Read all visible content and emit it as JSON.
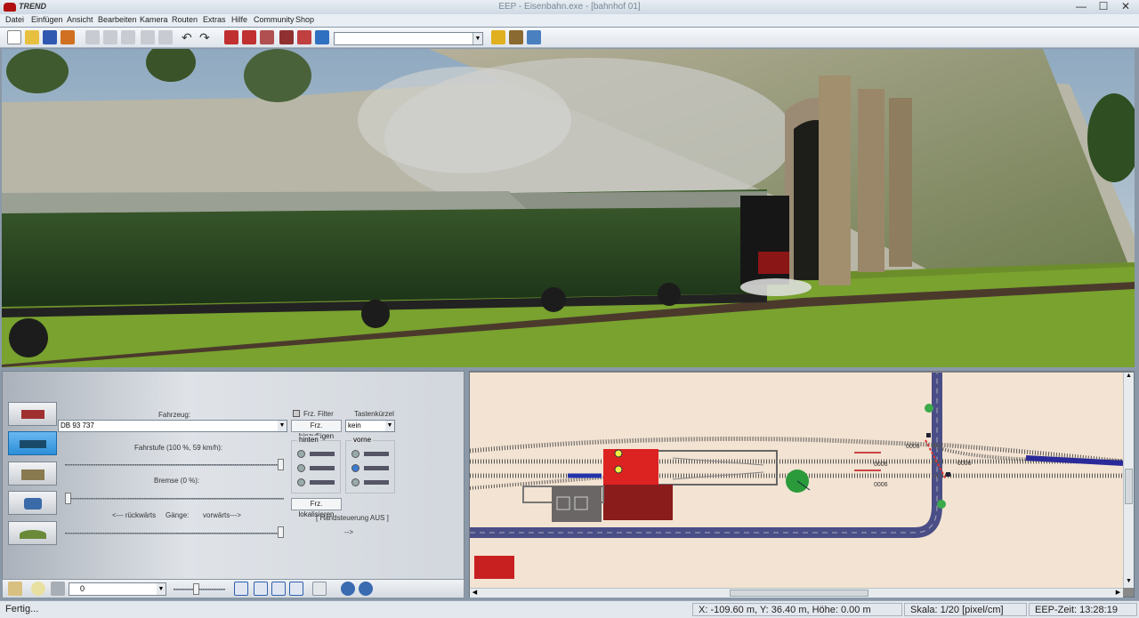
{
  "window": {
    "title": "EEP - Eisenbahn.exe - [bahnhof 01]",
    "logo_text": "TREND",
    "minimize": "—",
    "maximize": "☐",
    "close": "✕"
  },
  "menu": [
    "Datei",
    "Einfügen",
    "Ansicht",
    "Bearbeiten",
    "Kamera",
    "Routen",
    "Extras",
    "Hilfe",
    "Community",
    "Shop"
  ],
  "toolbar": {
    "combo_value": ""
  },
  "control": {
    "vehicle_label": "Fahrzeug:",
    "vehicle_value": "DB 93 737",
    "speed_label": "Fahrstufe (100 %, 59 km/h):",
    "speed_level": 1.0,
    "brake_label": "Bremse (0 %):",
    "brake_level": 0.0,
    "back_label": "<--- rückwärts",
    "gears_label": "Gänge:",
    "forward_label": "vorwärts--->",
    "gear_level": 1.0,
    "filter_label": "Frz. Filter",
    "add_button": "Frz. hinzufügen",
    "shortcut_label": "Tastenkürzel",
    "shortcut_value": "kein",
    "rear_label": "hinten",
    "front_label": "vorne",
    "locate_button": "Frz. lokalisieren",
    "manual_status": "[ Handsteuerung AUS ]",
    "arrow": "-->"
  },
  "bottom_toolbar": {
    "combo_value": "0"
  },
  "map": {
    "signal_label_1": "0006",
    "signal_label_2": "0006",
    "signal_label_3": "0006",
    "signal_label_4": "0006"
  },
  "status": {
    "ready": "Fertig...",
    "coords": "X: -109.60 m, Y: 36.40 m, Höhe: 0.00 m",
    "scale": "Skala: 1/20 [pixel/cm]",
    "time": "EEP-Zeit: 13:28:19"
  }
}
